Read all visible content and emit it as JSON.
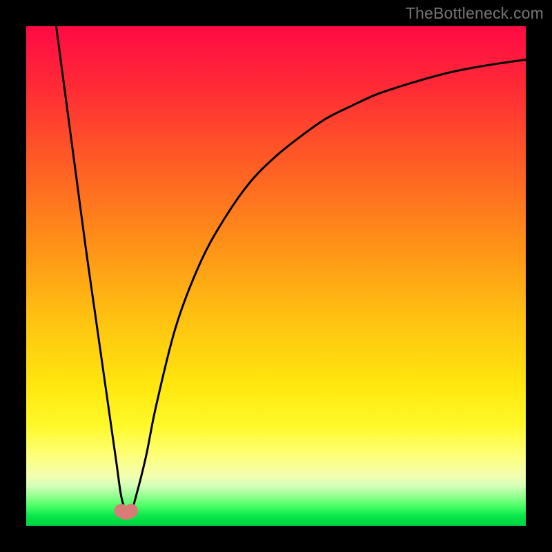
{
  "watermark": "TheBottleneck.com",
  "chart_data": {
    "type": "line",
    "title": "",
    "xlabel": "",
    "ylabel": "",
    "xlim": [
      0,
      100
    ],
    "ylim": [
      0,
      100
    ],
    "series": [
      {
        "name": "bottleneck-curve",
        "x": [
          6,
          8,
          10,
          12,
          14,
          16,
          18,
          19,
          20,
          21,
          22,
          24,
          26,
          30,
          35,
          40,
          45,
          50,
          55,
          60,
          65,
          70,
          75,
          80,
          85,
          90,
          95,
          100
        ],
        "y": [
          100,
          85,
          70,
          55,
          41,
          27,
          13,
          6,
          3,
          3,
          6,
          14,
          24,
          40,
          53,
          62,
          69,
          74,
          78,
          81.5,
          84,
          86.3,
          88,
          89.5,
          90.8,
          91.8,
          92.6,
          93.3
        ]
      }
    ],
    "markers": [
      {
        "name": "dip-left",
        "x": 19.0,
        "y": 3.0
      },
      {
        "name": "dip-right",
        "x": 21.0,
        "y": 3.0
      }
    ],
    "colors": {
      "curve": "#000000",
      "marker": "#d87c77",
      "gradient_top": "#ff0a44",
      "gradient_bottom": "#00d440"
    }
  }
}
